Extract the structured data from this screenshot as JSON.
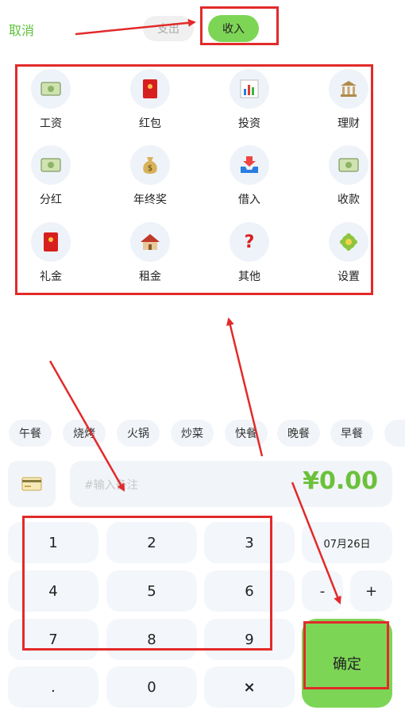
{
  "header": {
    "cancel_label": "取消",
    "tabs": [
      {
        "label": "支出"
      },
      {
        "label": "收入"
      }
    ]
  },
  "categories": [
    {
      "label": "工资",
      "icon": "money-icon"
    },
    {
      "label": "红包",
      "icon": "red-envelope-icon"
    },
    {
      "label": "投资",
      "icon": "bar-chart-icon"
    },
    {
      "label": "理财",
      "icon": "bank-icon"
    },
    {
      "label": "分红",
      "icon": "money-icon"
    },
    {
      "label": "年终奖",
      "icon": "money-bag-icon"
    },
    {
      "label": "借入",
      "icon": "inbox-icon"
    },
    {
      "label": "收款",
      "icon": "money-icon"
    },
    {
      "label": "礼金",
      "icon": "red-envelope-icon"
    },
    {
      "label": "租金",
      "icon": "house-icon"
    },
    {
      "label": "其他",
      "icon": "question-icon"
    },
    {
      "label": "设置",
      "icon": "gear-icon"
    }
  ],
  "tags": [
    "午餐",
    "烧烤",
    "火锅",
    "炒菜",
    "快餐",
    "晚餐",
    "早餐"
  ],
  "input": {
    "note_placeholder": "#输入备注",
    "amount": "¥0.00",
    "card_icon": "credit-card-icon"
  },
  "keypad": {
    "keys": [
      "1",
      "2",
      "3",
      "4",
      "5",
      "6",
      "7",
      "8",
      "9",
      ".",
      "0",
      "×"
    ],
    "date": "07月26日",
    "minus": "-",
    "plus": "+",
    "confirm": "确定"
  },
  "colors": {
    "accent": "#7dd556",
    "amount": "#6cc13b",
    "annotation": "#e22a2a",
    "key_bg": "#f3f6fa"
  }
}
